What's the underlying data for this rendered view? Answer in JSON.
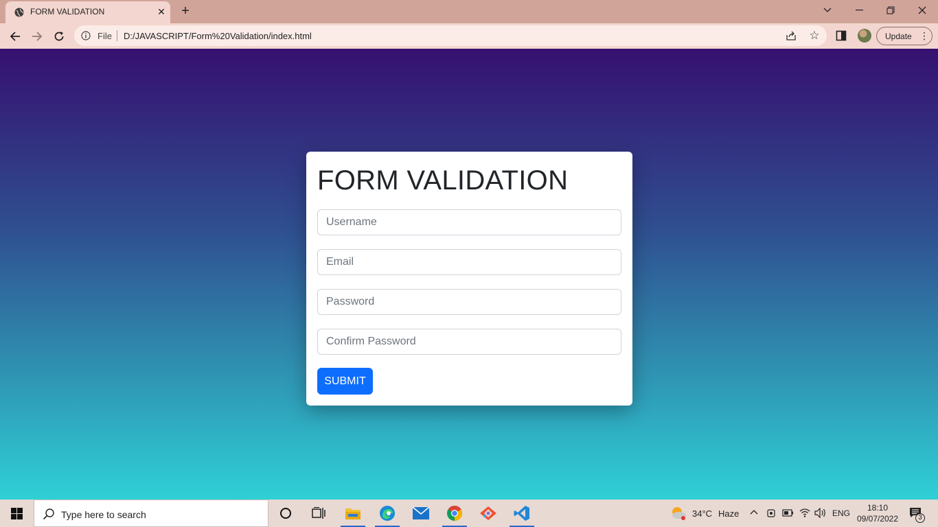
{
  "browser": {
    "tab_title": "FORM VALIDATION",
    "tab_close": "✕",
    "new_tab": "+",
    "scheme_label": "File",
    "url": "D:/JAVASCRIPT/Form%20Validation/index.html",
    "update_label": "Update",
    "menu_dots": "⋮"
  },
  "form": {
    "title": "FORM VALIDATION",
    "username_placeholder": "Username",
    "email_placeholder": "Email",
    "password_placeholder": "Password",
    "confirm_placeholder": "Confirm Password",
    "submit_label": "SUBMIT"
  },
  "taskbar": {
    "search_placeholder": "Type here to search",
    "weather_temp": "34°C",
    "weather_desc": "Haze",
    "language": "ENG",
    "time": "18:10",
    "date": "09/07/2022",
    "notification_count": "3"
  },
  "colors": {
    "gradient_top": "#361070",
    "gradient_bottom": "#2fd0d6",
    "submit_button": "#0d6efd",
    "tab_strip": "#d1a49a",
    "toolbar": "#f3d6cf"
  }
}
